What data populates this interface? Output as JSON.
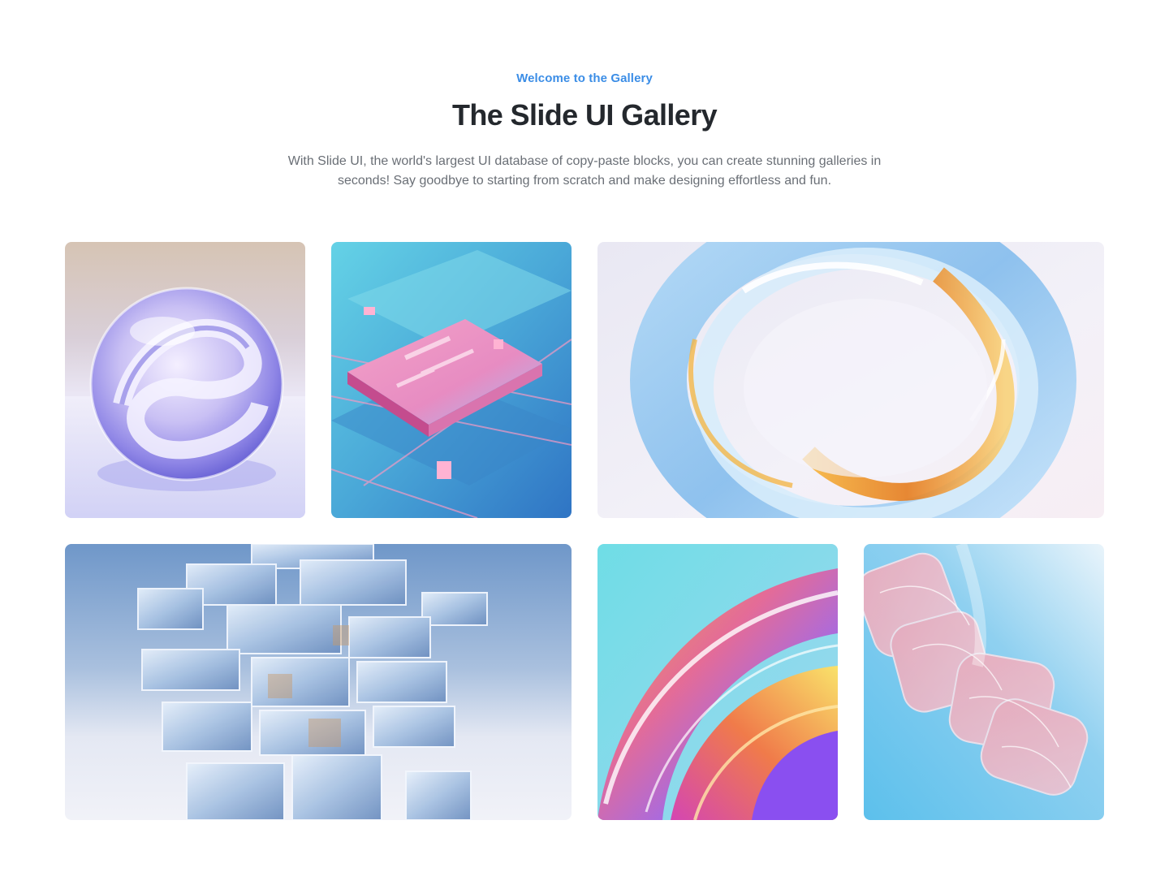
{
  "header": {
    "eyebrow": "Welcome to the Gallery",
    "title": "The Slide UI Gallery",
    "description": "With Slide UI, the world's largest UI database of copy-paste blocks, you can create stunning galleries in seconds! Say goodbye to starting from scratch and make designing effortless and fun."
  },
  "colors": {
    "accent": "#3b8de6",
    "title": "#24282d",
    "body_text": "#6a6f76"
  },
  "gallery": {
    "images": [
      {
        "name": "glass-sphere-image"
      },
      {
        "name": "circuit-chip-image"
      },
      {
        "name": "glass-ring-image"
      },
      {
        "name": "glass-cubes-tower-image"
      },
      {
        "name": "iridescent-swirl-image"
      },
      {
        "name": "pink-glass-ribbon-image"
      }
    ]
  }
}
